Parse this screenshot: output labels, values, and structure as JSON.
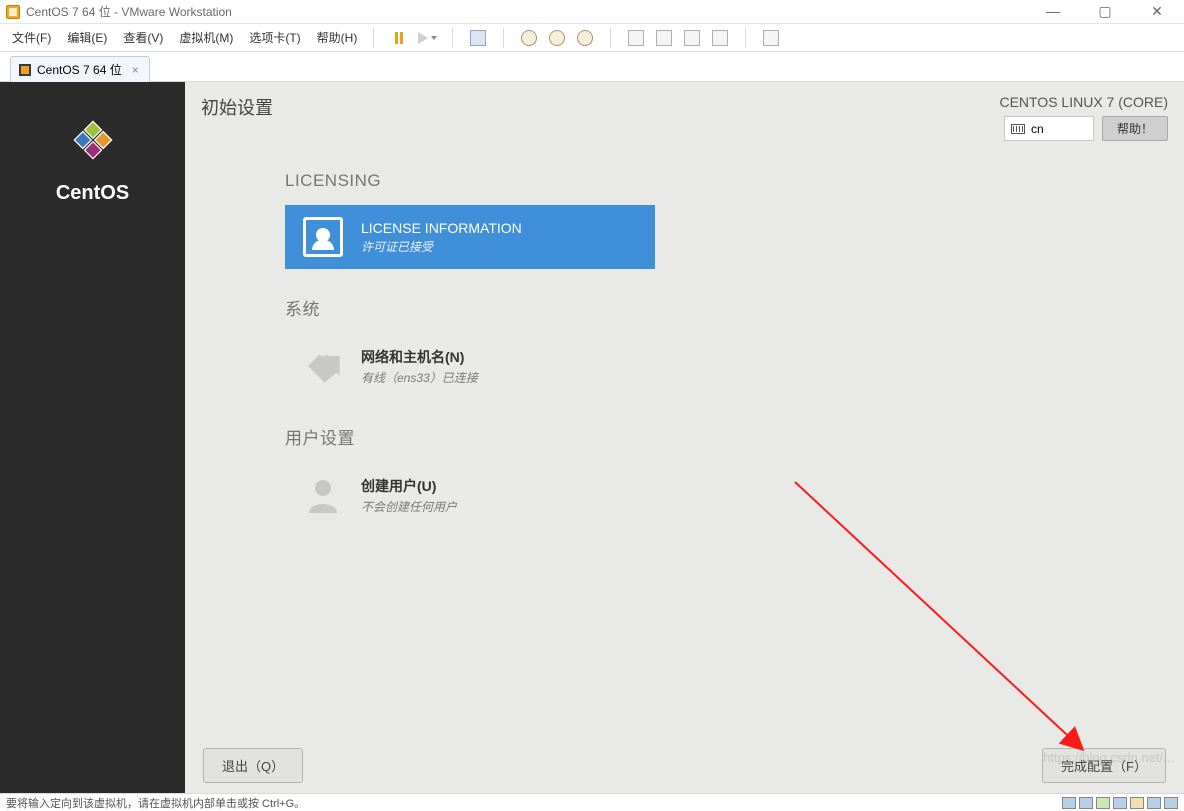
{
  "window": {
    "title": "CentOS 7 64 位 - VMware Workstation"
  },
  "menus": {
    "file": "文件(F)",
    "edit": "编辑(E)",
    "view": "查看(V)",
    "vm": "虚拟机(M)",
    "tabs": "选项卡(T)",
    "help": "帮助(H)"
  },
  "tab": {
    "label": "CentOS 7 64 位"
  },
  "sidebar": {
    "brand": "CentOS"
  },
  "header": {
    "title": "初始设置",
    "distro": "CENTOS LINUX 7 (CORE)",
    "lang_indicator": "cn",
    "help_label": "帮助！"
  },
  "sections": {
    "licensing": {
      "head": "LICENSING",
      "tile_title": "LICENSE INFORMATION",
      "tile_sub": "许可证已接受"
    },
    "system": {
      "head": "系统",
      "tile_title": "网络和主机名(N)",
      "tile_sub": "有线（ens33）已连接"
    },
    "users": {
      "head": "用户设置",
      "tile_title": "创建用户(U)",
      "tile_sub": "不会创建任何用户"
    }
  },
  "footer": {
    "quit": "退出（Q）",
    "finish": "完成配置（F）"
  },
  "statusbar": {
    "hint": "要将输入定向到该虚拟机，请在虚拟机内部单击或按 Ctrl+G。"
  },
  "watermark": "https://blog.csdn.net/..."
}
